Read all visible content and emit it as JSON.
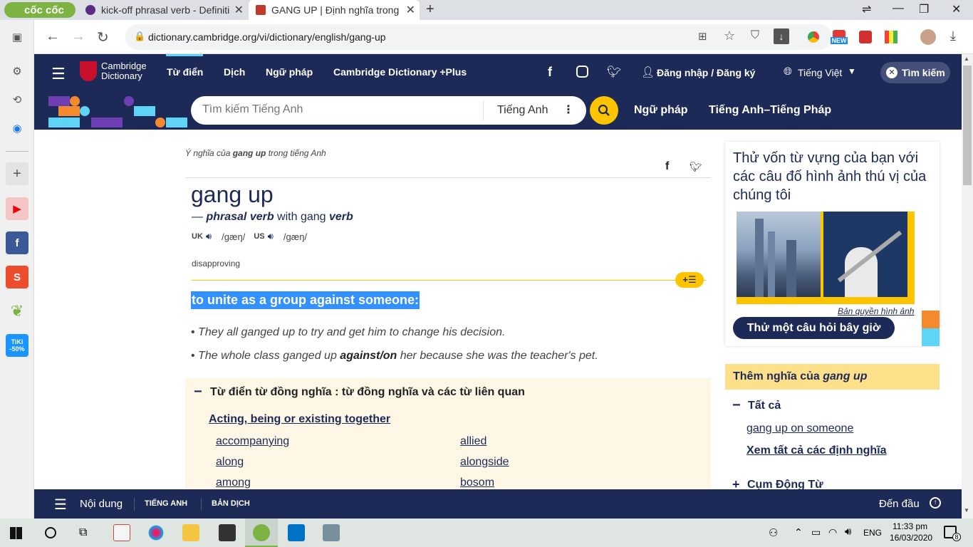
{
  "browser": {
    "brand": "cốc cốc",
    "tabs": [
      {
        "title": "kick-off phrasal verb - Definiti"
      },
      {
        "title": "GANG UP | Định nghĩa trong"
      }
    ],
    "url": "dictionary.cambridge.org/vi/dictionary/english/gang-up",
    "badge_new": "NEW"
  },
  "site": {
    "logo_line1": "Cambridge",
    "logo_line2": "Dictionary",
    "nav": [
      "Từ điển",
      "Dịch",
      "Ngữ pháp",
      "Cambridge Dictionary +Plus"
    ],
    "login": "Đăng nhập / Đăng ký",
    "language": "Tiếng Việt",
    "search_button": "Tìm kiếm",
    "search_placeholder": "Tìm kiếm Tiếng Anh",
    "search_lang": "Tiếng Anh",
    "sub_links": [
      "Ngữ pháp",
      "Tiếng Anh–Tiếng Pháp"
    ]
  },
  "entry": {
    "meaning_of_prefix": "Ý nghĩa của ",
    "meaning_word": "gang up",
    "meaning_suffix": " trong tiếng Anh",
    "headword": "gang up",
    "pos_dash": "—",
    "pos": "phrasal verb",
    "with": " with gang ",
    "verb": "verb",
    "uk": "UK",
    "us": "US",
    "pron_uk": "/ɡæŋ/",
    "pron_us": "/ɡæŋ/",
    "usage": "disapproving",
    "definition": "to unite as a group against someone:",
    "examples": [
      "They all ganged up to try and get him to change his decision.",
      "The whole class ganged up "
    ],
    "example2_bold": "against/on",
    "example2_tail": " her because she was the teacher's pet.",
    "thesaurus_title": "Từ điển từ đồng nghĩa : từ đồng nghĩa và các từ liên quan",
    "thesaurus_group": "Acting, being or existing together",
    "synonyms": [
      "accompanying",
      "allied",
      "along",
      "alongside",
      "among",
      "bosom"
    ]
  },
  "sidebar": {
    "quiz_text": "Thử vốn từ vựng của bạn với các câu đố hình ảnh thú vị của chúng tôi",
    "copyright": "Bản quyền hình ảnh",
    "quiz_button": "Thử một câu hỏi bây giờ",
    "more_prefix": "Thêm nghĩa của ",
    "more_word": "gang up",
    "all": "Tất cả",
    "link1": "gang up on someone",
    "see_all": "Xem tất cả các định nghĩa",
    "phrasal": "Cụm Động Từ"
  },
  "footer": {
    "contents": "Nội dung",
    "english": "TIẾNG ANH",
    "translation": "BẢN DỊCH",
    "top": "Đến đầu"
  },
  "taskbar": {
    "lang": "ENG",
    "time": "11:33 pm",
    "date": "16/03/2020",
    "notif": "8"
  },
  "colors": {
    "navy": "#1d2a57",
    "yellow": "#fec400",
    "highlight": "#3390ff",
    "thesaurus_bg": "#fef7e5"
  }
}
